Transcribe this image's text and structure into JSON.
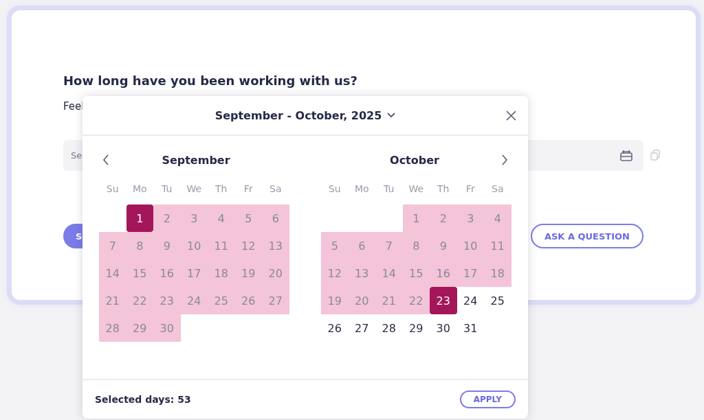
{
  "question": {
    "title": "How long have you been working with us?",
    "hint": "Feel",
    "field": {
      "placeholder": "Se"
    },
    "submit_button": "S",
    "ask_button": "ASK A QUESTION"
  },
  "date_picker": {
    "title": "September - October, 2025",
    "selected_days": "Selected days: 53",
    "apply_button": "APPLY",
    "months": [
      {
        "name": "September",
        "weekdays": [
          "Su",
          "Mo",
          "Tu",
          "We",
          "Th",
          "Fr",
          "Sa"
        ],
        "weeks": [
          [
            {
              "kind": "blank"
            },
            {
              "label": "1",
              "kind": "endpoint"
            },
            {
              "label": "2",
              "kind": "range"
            },
            {
              "label": "3",
              "kind": "range"
            },
            {
              "label": "4",
              "kind": "range"
            },
            {
              "label": "5",
              "kind": "range"
            },
            {
              "label": "6",
              "kind": "range"
            }
          ],
          [
            {
              "label": "7",
              "kind": "range"
            },
            {
              "label": "8",
              "kind": "range"
            },
            {
              "label": "9",
              "kind": "range"
            },
            {
              "label": "10",
              "kind": "range"
            },
            {
              "label": "11",
              "kind": "range"
            },
            {
              "label": "12",
              "kind": "range"
            },
            {
              "label": "13",
              "kind": "range"
            }
          ],
          [
            {
              "label": "14",
              "kind": "range"
            },
            {
              "label": "15",
              "kind": "range"
            },
            {
              "label": "16",
              "kind": "range"
            },
            {
              "label": "17",
              "kind": "range"
            },
            {
              "label": "18",
              "kind": "range"
            },
            {
              "label": "19",
              "kind": "range"
            },
            {
              "label": "20",
              "kind": "range"
            }
          ],
          [
            {
              "label": "21",
              "kind": "range"
            },
            {
              "label": "22",
              "kind": "range"
            },
            {
              "label": "23",
              "kind": "range"
            },
            {
              "label": "24",
              "kind": "range"
            },
            {
              "label": "25",
              "kind": "range"
            },
            {
              "label": "26",
              "kind": "range"
            },
            {
              "label": "27",
              "kind": "range"
            }
          ],
          [
            {
              "label": "28",
              "kind": "range"
            },
            {
              "label": "29",
              "kind": "range"
            },
            {
              "label": "30",
              "kind": "range"
            }
          ]
        ]
      },
      {
        "name": "October",
        "weekdays": [
          "Su",
          "Mo",
          "Tu",
          "We",
          "Th",
          "Fr",
          "Sa"
        ],
        "weeks": [
          [
            {
              "kind": "blank"
            },
            {
              "kind": "blank"
            },
            {
              "kind": "blank"
            },
            {
              "label": "1",
              "kind": "range"
            },
            {
              "label": "2",
              "kind": "range"
            },
            {
              "label": "3",
              "kind": "range"
            },
            {
              "label": "4",
              "kind": "range"
            }
          ],
          [
            {
              "label": "5",
              "kind": "range"
            },
            {
              "label": "6",
              "kind": "range"
            },
            {
              "label": "7",
              "kind": "range"
            },
            {
              "label": "8",
              "kind": "range"
            },
            {
              "label": "9",
              "kind": "range"
            },
            {
              "label": "10",
              "kind": "range"
            },
            {
              "label": "11",
              "kind": "range"
            }
          ],
          [
            {
              "label": "12",
              "kind": "range"
            },
            {
              "label": "13",
              "kind": "range"
            },
            {
              "label": "14",
              "kind": "range"
            },
            {
              "label": "15",
              "kind": "range"
            },
            {
              "label": "16",
              "kind": "range"
            },
            {
              "label": "17",
              "kind": "range"
            },
            {
              "label": "18",
              "kind": "range"
            }
          ],
          [
            {
              "label": "19",
              "kind": "range"
            },
            {
              "label": "20",
              "kind": "range"
            },
            {
              "label": "21",
              "kind": "range"
            },
            {
              "label": "22",
              "kind": "range"
            },
            {
              "label": "23",
              "kind": "endpoint"
            },
            {
              "label": "24",
              "kind": "plain"
            },
            {
              "label": "25",
              "kind": "plain"
            }
          ],
          [
            {
              "label": "26",
              "kind": "plain"
            },
            {
              "label": "27",
              "kind": "plain"
            },
            {
              "label": "28",
              "kind": "plain"
            },
            {
              "label": "29",
              "kind": "plain"
            },
            {
              "label": "30",
              "kind": "plain"
            },
            {
              "label": "31",
              "kind": "plain"
            }
          ]
        ]
      }
    ]
  }
}
